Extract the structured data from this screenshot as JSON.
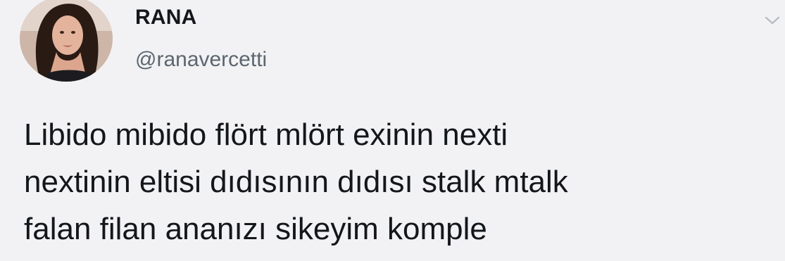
{
  "tweet": {
    "author": {
      "display_name": "RANA",
      "handle": "@ranavercetti",
      "avatar_icon": "profile-photo"
    },
    "menu_icon": "chevron-down-icon",
    "text_lines": [
      "Libido mibido flört mlört exinin nexti",
      "nextinin eltisi dıdısının dıdısı stalk mtalk",
      "falan filan ananızı sikeyim komple"
    ]
  },
  "colors": {
    "background": "#f2f2f4",
    "primary_text": "#14171a",
    "secondary_text": "#5b6670",
    "caret": "#b7bcc2"
  }
}
